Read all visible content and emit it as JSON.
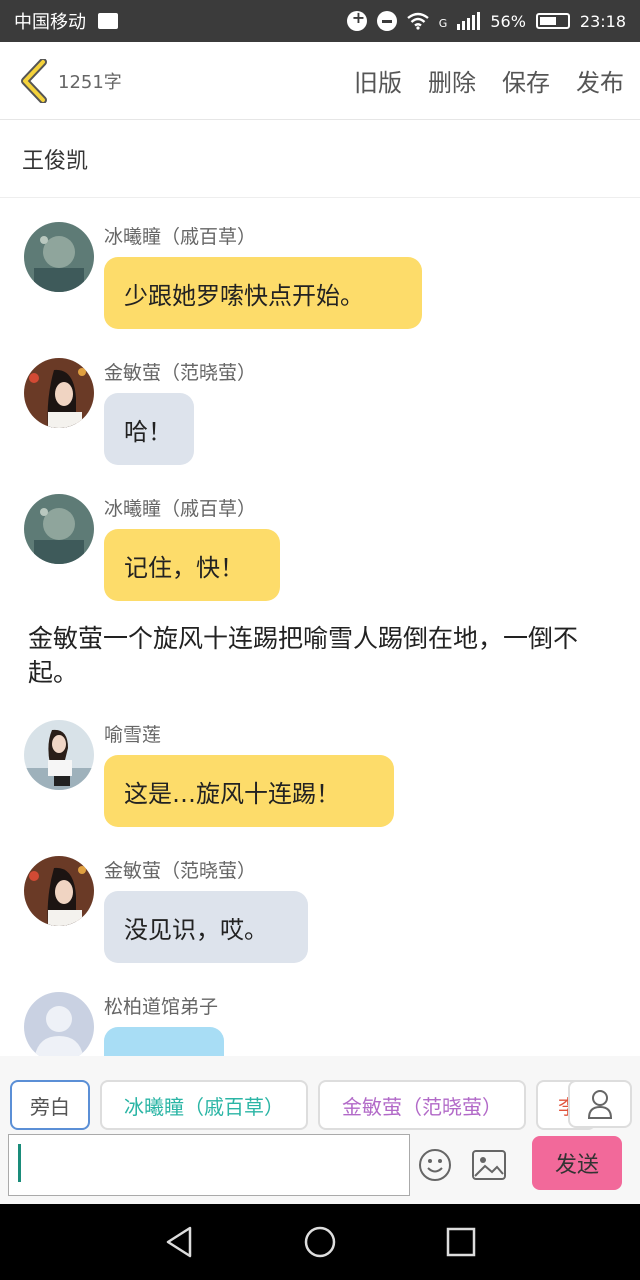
{
  "status": {
    "carrier": "中国移动",
    "network": "G",
    "battery": "56%",
    "time": "23:18"
  },
  "header": {
    "word_count": "1251字",
    "actions": [
      "旧版",
      "删除",
      "保存",
      "发布"
    ]
  },
  "story": {
    "title": "王俊凯"
  },
  "messages": [
    {
      "type": "bubble",
      "name": "冰曦瞳（戚百草）",
      "text": "少跟她罗嗦快点开始。",
      "style": "yellow",
      "avatar": "avatar-a"
    },
    {
      "type": "bubble",
      "name": "金敏萤（范晓萤）",
      "text": "哈！",
      "style": "gray",
      "avatar": "avatar-b"
    },
    {
      "type": "bubble",
      "name": "冰曦瞳（戚百草）",
      "text": "记住，快！",
      "style": "yellow",
      "avatar": "avatar-a"
    },
    {
      "type": "narration",
      "text": "金敏萤一个旋风十连踢把喻雪人踢倒在地，一倒不起。"
    },
    {
      "type": "bubble",
      "name": "喻雪莲",
      "text": "这是…旋风十连踢！",
      "style": "yellow",
      "avatar": "avatar-c"
    },
    {
      "type": "bubble",
      "name": "金敏萤（范晓萤）",
      "text": "没见识，哎。",
      "style": "gray",
      "avatar": "avatar-b"
    },
    {
      "type": "bubble",
      "name": "松柏道馆弟子",
      "text": "……",
      "style": "blue",
      "avatar": "avatar-default"
    }
  ],
  "characters": [
    {
      "label": "旁白",
      "color": "#555555"
    },
    {
      "label": "冰曦瞳（戚百草）",
      "color": "#2bb5a5"
    },
    {
      "label": "金敏萤（范晓萤）",
      "color": "#b26ac8"
    },
    {
      "label": "李",
      "color": "#e0533c"
    }
  ],
  "composer": {
    "placeholder": "",
    "send_label": "发送"
  },
  "colors": {
    "accent_teal": "#1a8c7a",
    "send_pink": "#f2699a",
    "bubble_yellow": "#fddc6a",
    "bubble_gray": "#dde3ec",
    "bubble_blue": "#a8ddf5"
  }
}
